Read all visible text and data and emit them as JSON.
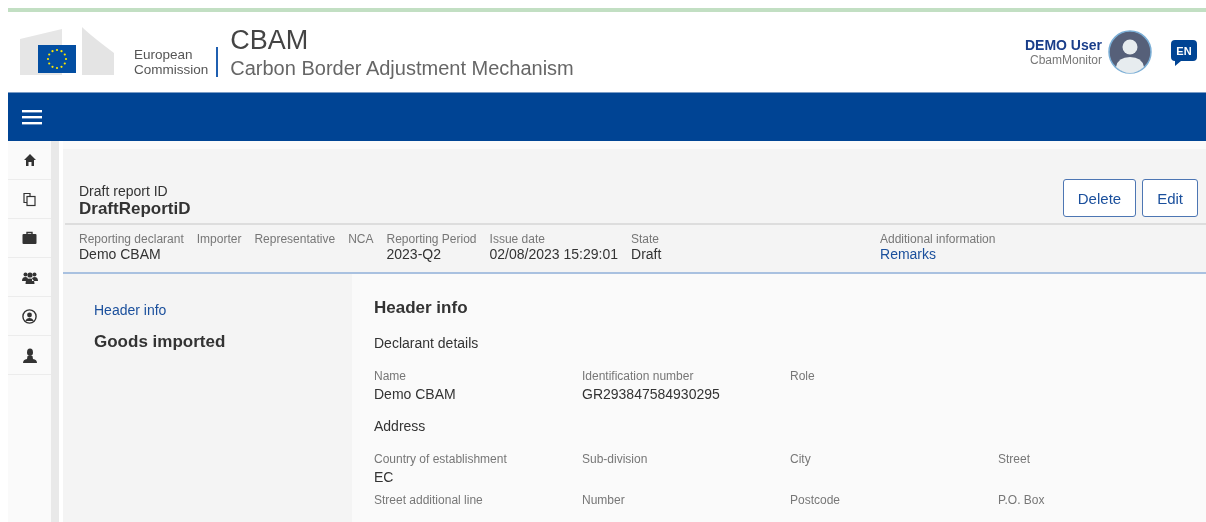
{
  "header": {
    "logo_lines": [
      "European",
      "Commission"
    ],
    "app_title": "CBAM",
    "app_subtitle": "Carbon Border Adjustment Mechanism",
    "user": {
      "name": "DEMO User",
      "role": "CbamMonitor"
    },
    "language": "EN"
  },
  "sidebar": {
    "items": [
      {
        "kind": "home"
      },
      {
        "kind": "copy"
      },
      {
        "kind": "briefcase"
      },
      {
        "kind": "users"
      },
      {
        "kind": "account"
      },
      {
        "kind": "person"
      }
    ]
  },
  "report": {
    "id_label": "Draft report ID",
    "id": "DraftReportiD",
    "actions": [
      "Delete",
      "Edit"
    ],
    "meta": [
      {
        "label": "Reporting declarant",
        "value": "Demo CBAM"
      },
      {
        "label": "Importer"
      },
      {
        "label": "Representative"
      },
      {
        "label": "NCA"
      },
      {
        "label": "Reporting Period",
        "value": "2023-Q2"
      },
      {
        "label": "Issue date",
        "value": "02/08/2023 15:29:01"
      },
      {
        "label": "State",
        "value": "Draft"
      },
      {
        "label": "Additional information",
        "value": "Remarks",
        "kind": "link"
      }
    ]
  },
  "nav": [
    {
      "label": "Header info",
      "kind": "link"
    },
    {
      "label": "Goods imported",
      "kind": "heading"
    }
  ],
  "detail": {
    "title": "Header info",
    "sections": [
      {
        "title": "Declarant details",
        "fields": [
          {
            "label": "Name",
            "value": "Demo CBAM"
          },
          {
            "label": "Identification number",
            "value": "GR293847584930295"
          },
          {
            "label": "Role"
          }
        ]
      },
      {
        "title": "Address",
        "fields": [
          {
            "label": "Country of establishment",
            "value": "EC"
          },
          {
            "label": "Sub-division"
          },
          {
            "label": "City"
          },
          {
            "label": "Street"
          },
          {
            "label": "Street additional line"
          },
          {
            "label": "Number"
          },
          {
            "label": "Postcode"
          },
          {
            "label": "P.O. Box"
          }
        ]
      }
    ]
  }
}
